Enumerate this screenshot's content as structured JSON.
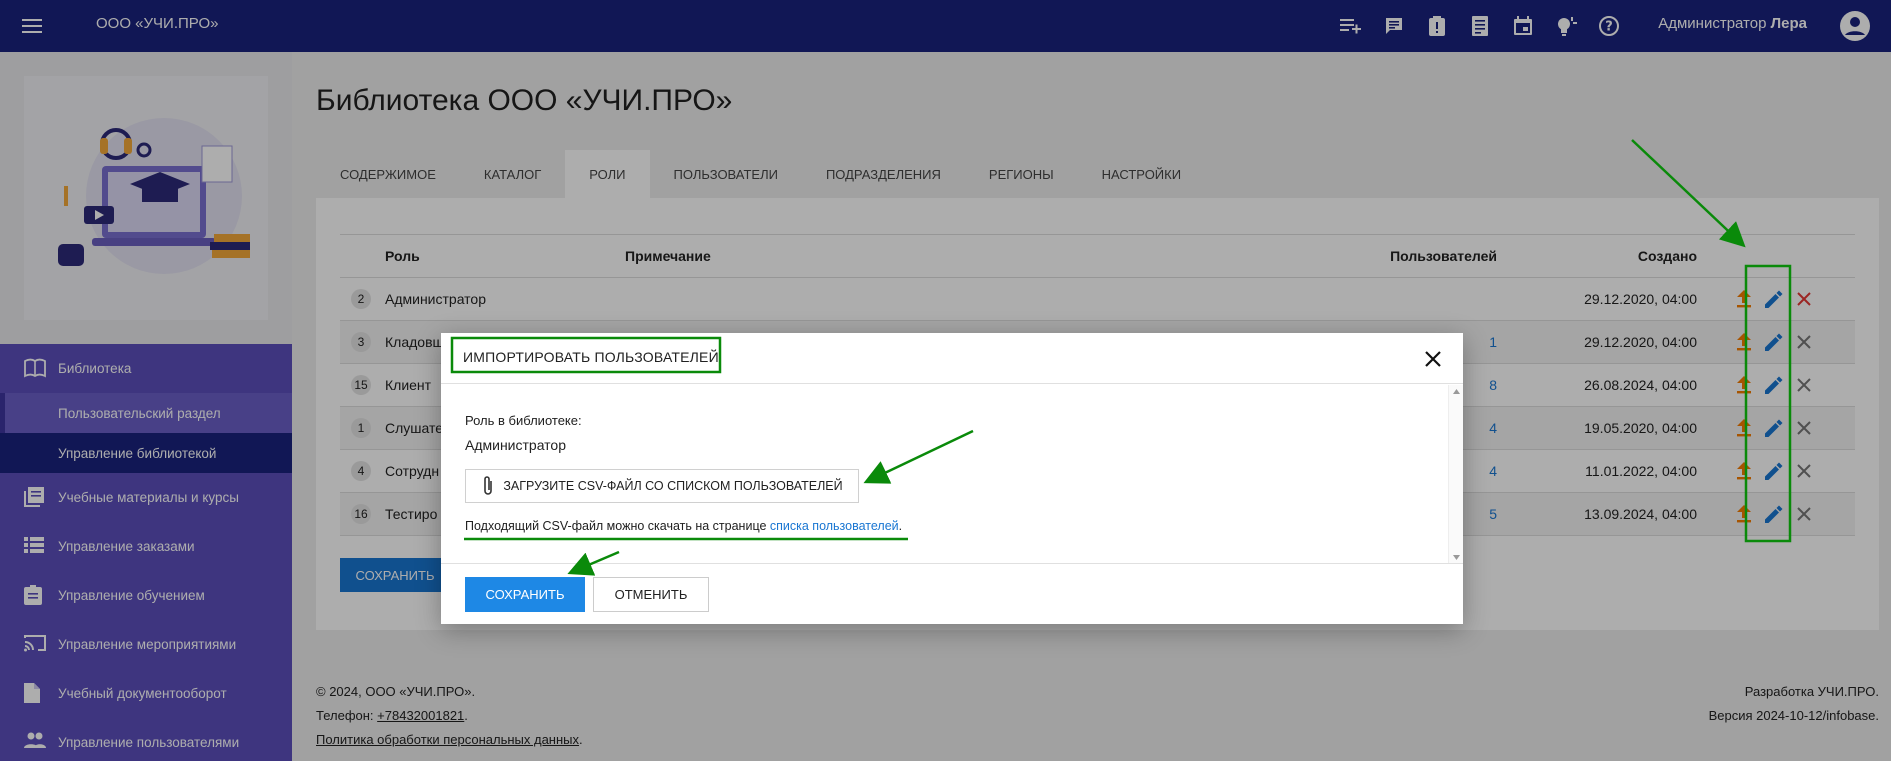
{
  "topbar": {
    "brand": "ООО «УЧИ.ПРО»",
    "user_prefix": "Администратор",
    "user_name": "Лера",
    "icons": [
      "playlist-add-icon",
      "chat-icon",
      "report-icon",
      "document-list-icon",
      "calendar-icon",
      "lightbulb-icon",
      "help-icon"
    ]
  },
  "sidebar": {
    "items": [
      {
        "label": "Библиотека",
        "icon": "book-icon"
      },
      {
        "label": "Учебные материалы и курсы",
        "icon": "library-books-icon"
      },
      {
        "label": "Управление заказами",
        "icon": "list-icon"
      },
      {
        "label": "Управление обучением",
        "icon": "assignment-icon"
      },
      {
        "label": "Управление мероприятиями",
        "icon": "cast-icon"
      },
      {
        "label": "Учебный документооборот",
        "icon": "document-icon"
      },
      {
        "label": "Управление пользователями",
        "icon": "people-icon"
      }
    ],
    "subitems": [
      "Пользовательский раздел",
      "Управление библиотекой"
    ]
  },
  "page": {
    "title": "Библиотека ООО «УЧИ.ПРО»",
    "tabs": [
      "Содержимое",
      "Каталог",
      "Роли",
      "Пользователи",
      "Подразделения",
      "Регионы",
      "Настройки"
    ],
    "active_tab": "Роли"
  },
  "table": {
    "headers": {
      "role": "Роль",
      "note": "Примечание",
      "users": "Пользователей",
      "created": "Создано"
    },
    "rows": [
      {
        "num": "2",
        "role": "Администратор",
        "note": "",
        "users": "",
        "created": "29.12.2020, 04:00"
      },
      {
        "num": "3",
        "role": "Кладовщ",
        "note": "",
        "users": "1",
        "created": "29.12.2020, 04:00"
      },
      {
        "num": "15",
        "role": "Клиент",
        "note": "",
        "users": "8",
        "created": "26.08.2024, 04:00"
      },
      {
        "num": "1",
        "role": "Слушате",
        "note": "",
        "users": "4",
        "created": "19.05.2020, 04:00"
      },
      {
        "num": "4",
        "role": "Сотрудн",
        "note": "",
        "users": "4",
        "created": "11.01.2022, 04:00"
      },
      {
        "num": "16",
        "role": "Тестиро",
        "note": "",
        "users": "5",
        "created": "13.09.2024, 04:00"
      }
    ],
    "save_label": "Сохранить"
  },
  "modal": {
    "title": "Импортировать пользователей",
    "role_label": "Роль в библиотеке:",
    "role_value": "Администратор",
    "upload_label": "Загрузите CSV-файл со списком пользователей",
    "hint_text": "Подходящий CSV-файл можно скачать на странице ",
    "hint_link": "списка пользователей",
    "hint_end": ".",
    "save_label": "Сохранить",
    "cancel_label": "Отменить"
  },
  "footer": {
    "copyright": "©  2024, ООО «УЧИ.ПРО».",
    "phone_prefix": "Телефон: ",
    "phone": "+78432001821",
    "phone_end": ".",
    "policy": "Политика обработки персональных данных",
    "policy_end": ".",
    "dev": "Разработка УЧИ.ПРО.",
    "version": "Версия 2024-10-12/infobase."
  },
  "colors": {
    "topbar": "#1a237e",
    "nav": "#5c4fbc",
    "primary": "#1e88e5",
    "upload_icon": "#f57c00",
    "edit_icon": "#1976d2",
    "delete_icon": "#e53935",
    "annotation": "#0a8a0a"
  }
}
